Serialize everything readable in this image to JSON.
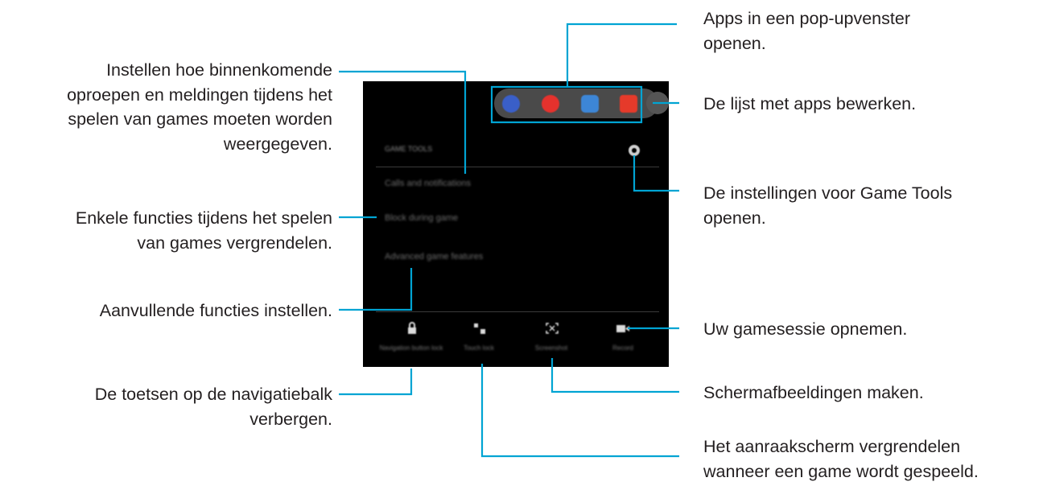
{
  "screen": {
    "header": "GAME TOOLS",
    "menu_items": [
      "Calls and notifications",
      "Block during game",
      "Advanced game features"
    ],
    "tools": [
      "Navigation button lock",
      "Touch lock",
      "Screenshot",
      "Record"
    ]
  },
  "callouts": {
    "left_1": [
      "Instellen hoe binnenkomende",
      "oproepen en meldingen tijdens het",
      "spelen van games moeten worden",
      "weergegeven."
    ],
    "left_2": [
      "Enkele functies tijdens het spelen",
      "van games vergrendelen."
    ],
    "left_3": [
      "Aanvullende functies instellen."
    ],
    "left_4": [
      "De toetsen op de navigatiebalk",
      "verbergen."
    ],
    "right_1": [
      "Apps in een pop-upvenster",
      "openen."
    ],
    "right_2": [
      "De lijst met apps bewerken."
    ],
    "right_3": [
      "De instellingen voor Game Tools",
      "openen."
    ],
    "right_4": [
      "Uw gamesessie opnemen."
    ],
    "right_5": [
      "Schermafbeeldingen maken."
    ],
    "right_6": [
      "Het aanraakscherm vergrendelen",
      "wanneer een game wordt gespeeld."
    ]
  },
  "colors": {
    "connector": "#00a4d3",
    "screen_bg": "#000000",
    "text": "#231f20"
  }
}
